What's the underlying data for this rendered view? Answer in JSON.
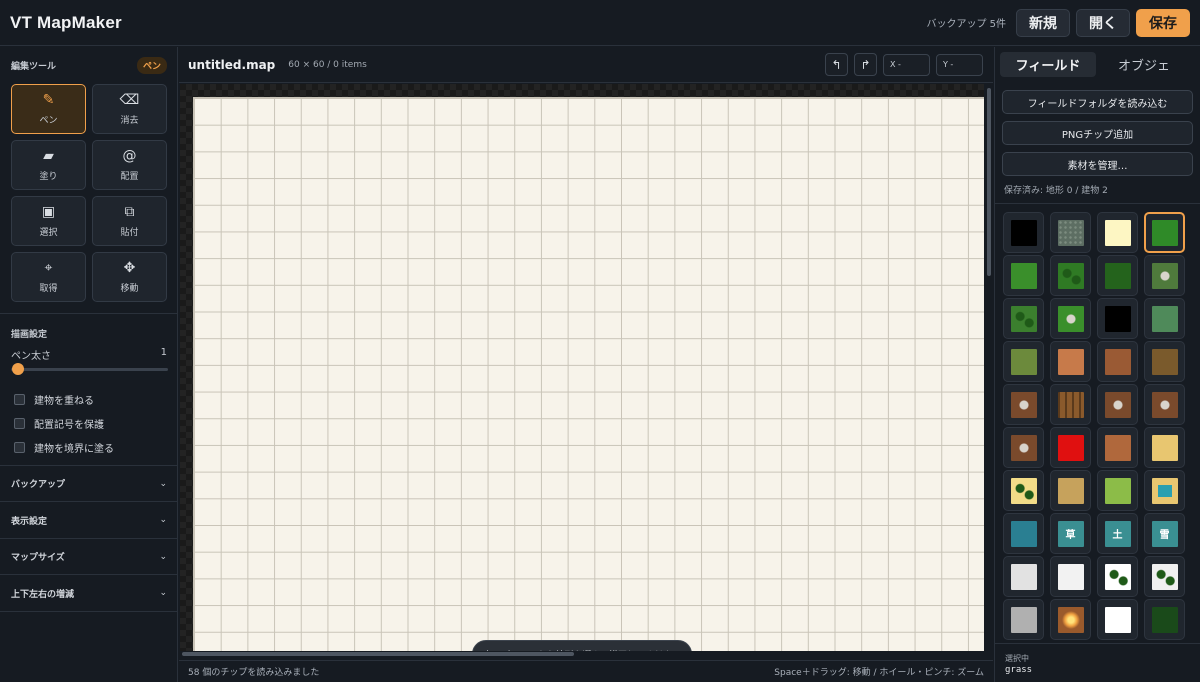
{
  "header": {
    "title": "VT MapMaker",
    "backup_count": "バックアップ 5件",
    "new_label": "新規",
    "open_label": "開く",
    "save_label": "保存"
  },
  "left": {
    "tools_title": "編集ツール",
    "active_badge": "ペン",
    "tools": [
      {
        "name": "pen",
        "label": "ペン",
        "icon": "pencil-icon",
        "glyph": "✎",
        "active": true
      },
      {
        "name": "erase",
        "label": "消去",
        "icon": "eraser-icon",
        "glyph": "⌫",
        "active": false
      },
      {
        "name": "fill",
        "label": "塗り",
        "icon": "fill-icon",
        "glyph": "▰",
        "active": false
      },
      {
        "name": "place",
        "label": "配置",
        "icon": "at-icon",
        "glyph": "@",
        "active": false
      },
      {
        "name": "select",
        "label": "選択",
        "icon": "select-icon",
        "glyph": "▣",
        "active": false
      },
      {
        "name": "paste",
        "label": "貼付",
        "icon": "paste-icon",
        "glyph": "⧉",
        "active": false
      },
      {
        "name": "pick",
        "label": "取得",
        "icon": "crosshair-icon",
        "glyph": "⌖",
        "active": false
      },
      {
        "name": "move",
        "label": "移動",
        "icon": "move-icon",
        "glyph": "✥",
        "active": false
      }
    ],
    "draw_settings_title": "描画設定",
    "pen_size_label": "ペン太さ",
    "pen_size_value": "1",
    "pen_size_fraction": 0.0,
    "checks": [
      {
        "label": "建物を重ねる",
        "checked": false
      },
      {
        "label": "配置記号を保護",
        "checked": false
      },
      {
        "label": "建物を境界に塗る",
        "checked": false
      }
    ],
    "accordions": [
      "バックアップ",
      "表示設定",
      "マップサイズ",
      "上下左右の増減"
    ]
  },
  "center": {
    "map_name": "untitled.map",
    "map_info": "60 × 60 / 0 items",
    "undo_icon": "undo-icon",
    "redo_icon": "redo-icon",
    "x_label": "X -",
    "y_label": "Y -",
    "toast": "右のパレットから地形を選んで描画してください",
    "status_left": "58 個のチップを読み込みました",
    "status_right": "Space＋ドラッグ: 移動 / ホイール・ピンチ: ズーム"
  },
  "right": {
    "tab_field": "フィールド",
    "tab_object": "オブジェ",
    "load_folder": "フィールドフォルダを読み込む",
    "add_png": "PNGチップ追加",
    "manage": "素材を管理…",
    "saved": "保存済み: 地形 0 / 建物 2",
    "selected_label": "選択中",
    "selected_value": "grass"
  },
  "palette": [
    {
      "color": "#000000"
    },
    {
      "color": "#5d6e63",
      "pattern": "stone"
    },
    {
      "color": "#fdf6c3"
    },
    {
      "color": "#2f8a28",
      "selected": true
    },
    {
      "color": "#3a8f2b"
    },
    {
      "color": "#2f7a24",
      "pattern": "tree"
    },
    {
      "color": "#24631c"
    },
    {
      "color": "#4f7a3c",
      "pattern": "rock"
    },
    {
      "color": "#3b7f2e",
      "pattern": "tree"
    },
    {
      "color": "#3a8f2b",
      "pattern": "rock"
    },
    {
      "color": "#000000"
    },
    {
      "color": "#4f8a5a"
    },
    {
      "color": "#6c8a3c"
    },
    {
      "color": "#c77a4a"
    },
    {
      "color": "#9a5a34"
    },
    {
      "color": "#7a5a2c"
    },
    {
      "color": "#7a4a2c",
      "pattern": "rock"
    },
    {
      "color": "#8a5a2c",
      "pattern": "fence"
    },
    {
      "color": "#7a4a2c",
      "pattern": "rock"
    },
    {
      "color": "#7a4a2c",
      "pattern": "rock"
    },
    {
      "color": "#7a4a2c",
      "pattern": "rock"
    },
    {
      "color": "#e01010"
    },
    {
      "color": "#b0683c"
    },
    {
      "color": "#e8c670"
    },
    {
      "color": "#f2dc88",
      "pattern": "tree"
    },
    {
      "color": "#c6a25c"
    },
    {
      "color": "#8cbc48"
    },
    {
      "color": "#e8c670",
      "pattern": "water"
    },
    {
      "color": "#2a7f92"
    },
    {
      "color": "#3a8f92",
      "text": "草"
    },
    {
      "color": "#3a8f92",
      "text": "土"
    },
    {
      "color": "#3a8f92",
      "text": "雪"
    },
    {
      "color": "#e2e2e2"
    },
    {
      "color": "#f2f2f2"
    },
    {
      "color": "#ffffff",
      "pattern": "tree"
    },
    {
      "color": "#f0f0f0",
      "pattern": "tree"
    },
    {
      "color": "#b0b0b0"
    },
    {
      "color": "#9a5a2c",
      "pattern": "burst"
    },
    {
      "color": "#ffffff"
    },
    {
      "color": "#1a4a1a"
    }
  ]
}
